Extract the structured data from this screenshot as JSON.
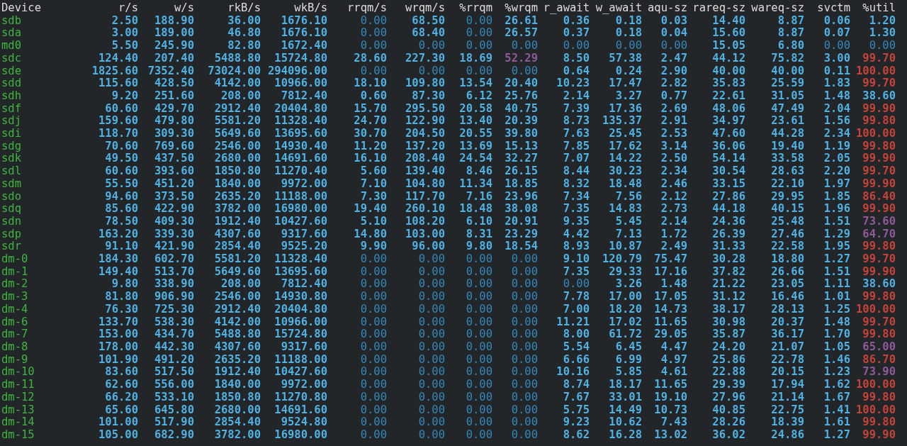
{
  "columns": [
    "Device",
    "r/s",
    "w/s",
    "rkB/s",
    "wkB/s",
    "rrqm/s",
    "wrqm/s",
    "%rrqm",
    "%wrqm",
    "r_await",
    "w_await",
    "aqu-sz",
    "rareq-sz",
    "wareq-sz",
    "svctm",
    "%util"
  ],
  "rows": [
    {
      "device": "sdb",
      "cells": [
        {
          "text": "2.50",
          "kind": "value"
        },
        {
          "text": "188.90",
          "kind": "value"
        },
        {
          "text": "36.00",
          "kind": "value"
        },
        {
          "text": "1676.10",
          "kind": "value"
        },
        {
          "text": "0.00",
          "kind": "zero"
        },
        {
          "text": "68.50",
          "kind": "value"
        },
        {
          "text": "0.00",
          "kind": "zero"
        },
        {
          "text": "26.61",
          "kind": "value"
        },
        {
          "text": "0.36",
          "kind": "value"
        },
        {
          "text": "0.18",
          "kind": "value"
        },
        {
          "text": "0.03",
          "kind": "value"
        },
        {
          "text": "14.40",
          "kind": "value"
        },
        {
          "text": "8.87",
          "kind": "value"
        },
        {
          "text": "0.06",
          "kind": "value"
        },
        {
          "text": "1.20",
          "kind": "value"
        }
      ]
    },
    {
      "device": "sda",
      "cells": [
        {
          "text": "3.00",
          "kind": "value"
        },
        {
          "text": "189.00",
          "kind": "value"
        },
        {
          "text": "46.80",
          "kind": "value"
        },
        {
          "text": "1676.10",
          "kind": "value"
        },
        {
          "text": "0.00",
          "kind": "zero"
        },
        {
          "text": "68.40",
          "kind": "value"
        },
        {
          "text": "0.00",
          "kind": "zero"
        },
        {
          "text": "26.57",
          "kind": "value"
        },
        {
          "text": "0.37",
          "kind": "value"
        },
        {
          "text": "0.18",
          "kind": "value"
        },
        {
          "text": "0.04",
          "kind": "value"
        },
        {
          "text": "15.60",
          "kind": "value"
        },
        {
          "text": "8.87",
          "kind": "value"
        },
        {
          "text": "0.07",
          "kind": "value"
        },
        {
          "text": "1.30",
          "kind": "value"
        }
      ]
    },
    {
      "device": "md0",
      "cells": [
        {
          "text": "5.50",
          "kind": "value"
        },
        {
          "text": "245.90",
          "kind": "value"
        },
        {
          "text": "82.80",
          "kind": "value"
        },
        {
          "text": "1672.40",
          "kind": "value"
        },
        {
          "text": "0.00",
          "kind": "zero"
        },
        {
          "text": "0.00",
          "kind": "zero"
        },
        {
          "text": "0.00",
          "kind": "zero"
        },
        {
          "text": "0.00",
          "kind": "zero"
        },
        {
          "text": "0.00",
          "kind": "zero"
        },
        {
          "text": "0.00",
          "kind": "zero"
        },
        {
          "text": "0.00",
          "kind": "zero"
        },
        {
          "text": "15.05",
          "kind": "value"
        },
        {
          "text": "6.80",
          "kind": "value"
        },
        {
          "text": "0.00",
          "kind": "zero"
        },
        {
          "text": "0.00",
          "kind": "zero"
        }
      ]
    },
    {
      "device": "sdc",
      "cells": [
        {
          "text": "124.40",
          "kind": "value"
        },
        {
          "text": "207.40",
          "kind": "value"
        },
        {
          "text": "5488.80",
          "kind": "value"
        },
        {
          "text": "15724.80",
          "kind": "value"
        },
        {
          "text": "28.60",
          "kind": "value"
        },
        {
          "text": "227.30",
          "kind": "value"
        },
        {
          "text": "18.69",
          "kind": "value"
        },
        {
          "text": "52.29",
          "kind": "mid"
        },
        {
          "text": "8.50",
          "kind": "value"
        },
        {
          "text": "57.38",
          "kind": "value"
        },
        {
          "text": "2.47",
          "kind": "value"
        },
        {
          "text": "44.12",
          "kind": "value"
        },
        {
          "text": "75.82",
          "kind": "value"
        },
        {
          "text": "3.00",
          "kind": "value"
        },
        {
          "text": "99.70",
          "kind": "high"
        }
      ]
    },
    {
      "device": "sde",
      "cells": [
        {
          "text": "1825.60",
          "kind": "value"
        },
        {
          "text": "7352.40",
          "kind": "value"
        },
        {
          "text": "73024.00",
          "kind": "value"
        },
        {
          "text": "294096.00",
          "kind": "value"
        },
        {
          "text": "0.00",
          "kind": "zero"
        },
        {
          "text": "0.00",
          "kind": "zero"
        },
        {
          "text": "0.00",
          "kind": "zero"
        },
        {
          "text": "0.00",
          "kind": "zero"
        },
        {
          "text": "0.64",
          "kind": "value"
        },
        {
          "text": "0.24",
          "kind": "value"
        },
        {
          "text": "2.90",
          "kind": "value"
        },
        {
          "text": "40.00",
          "kind": "value"
        },
        {
          "text": "40.00",
          "kind": "value"
        },
        {
          "text": "0.11",
          "kind": "value"
        },
        {
          "text": "100.00",
          "kind": "high"
        }
      ]
    },
    {
      "device": "sdd",
      "cells": [
        {
          "text": "115.60",
          "kind": "value"
        },
        {
          "text": "428.50",
          "kind": "value"
        },
        {
          "text": "4142.00",
          "kind": "value"
        },
        {
          "text": "10966.00",
          "kind": "value"
        },
        {
          "text": "18.10",
          "kind": "value"
        },
        {
          "text": "109.80",
          "kind": "value"
        },
        {
          "text": "13.54",
          "kind": "value"
        },
        {
          "text": "20.40",
          "kind": "value"
        },
        {
          "text": "10.23",
          "kind": "value"
        },
        {
          "text": "17.47",
          "kind": "value"
        },
        {
          "text": "2.82",
          "kind": "value"
        },
        {
          "text": "35.83",
          "kind": "value"
        },
        {
          "text": "25.59",
          "kind": "value"
        },
        {
          "text": "1.83",
          "kind": "value"
        },
        {
          "text": "99.70",
          "kind": "high"
        }
      ]
    },
    {
      "device": "sdh",
      "cells": [
        {
          "text": "9.20",
          "kind": "value"
        },
        {
          "text": "251.60",
          "kind": "value"
        },
        {
          "text": "208.00",
          "kind": "value"
        },
        {
          "text": "7812.40",
          "kind": "value"
        },
        {
          "text": "0.60",
          "kind": "value"
        },
        {
          "text": "87.30",
          "kind": "value"
        },
        {
          "text": "6.12",
          "kind": "value"
        },
        {
          "text": "25.76",
          "kind": "value"
        },
        {
          "text": "2.14",
          "kind": "value"
        },
        {
          "text": "3.27",
          "kind": "value"
        },
        {
          "text": "0.77",
          "kind": "value"
        },
        {
          "text": "22.61",
          "kind": "value"
        },
        {
          "text": "31.05",
          "kind": "value"
        },
        {
          "text": "1.48",
          "kind": "value"
        },
        {
          "text": "38.60",
          "kind": "value"
        }
      ]
    },
    {
      "device": "sdf",
      "cells": [
        {
          "text": "60.60",
          "kind": "value"
        },
        {
          "text": "429.70",
          "kind": "value"
        },
        {
          "text": "2912.40",
          "kind": "value"
        },
        {
          "text": "20404.80",
          "kind": "value"
        },
        {
          "text": "15.70",
          "kind": "value"
        },
        {
          "text": "295.50",
          "kind": "value"
        },
        {
          "text": "20.58",
          "kind": "value"
        },
        {
          "text": "40.75",
          "kind": "value"
        },
        {
          "text": "7.39",
          "kind": "value"
        },
        {
          "text": "17.36",
          "kind": "value"
        },
        {
          "text": "2.69",
          "kind": "value"
        },
        {
          "text": "48.06",
          "kind": "value"
        },
        {
          "text": "47.49",
          "kind": "value"
        },
        {
          "text": "2.04",
          "kind": "value"
        },
        {
          "text": "99.90",
          "kind": "high"
        }
      ]
    },
    {
      "device": "sdj",
      "cells": [
        {
          "text": "159.60",
          "kind": "value"
        },
        {
          "text": "479.80",
          "kind": "value"
        },
        {
          "text": "5581.20",
          "kind": "value"
        },
        {
          "text": "11328.40",
          "kind": "value"
        },
        {
          "text": "24.70",
          "kind": "value"
        },
        {
          "text": "122.90",
          "kind": "value"
        },
        {
          "text": "13.40",
          "kind": "value"
        },
        {
          "text": "20.39",
          "kind": "value"
        },
        {
          "text": "8.73",
          "kind": "value"
        },
        {
          "text": "135.37",
          "kind": "value"
        },
        {
          "text": "2.91",
          "kind": "value"
        },
        {
          "text": "34.97",
          "kind": "value"
        },
        {
          "text": "23.61",
          "kind": "value"
        },
        {
          "text": "1.56",
          "kind": "value"
        },
        {
          "text": "99.80",
          "kind": "high"
        }
      ]
    },
    {
      "device": "sdi",
      "cells": [
        {
          "text": "118.70",
          "kind": "value"
        },
        {
          "text": "309.30",
          "kind": "value"
        },
        {
          "text": "5649.60",
          "kind": "value"
        },
        {
          "text": "13695.60",
          "kind": "value"
        },
        {
          "text": "30.70",
          "kind": "value"
        },
        {
          "text": "204.50",
          "kind": "value"
        },
        {
          "text": "20.55",
          "kind": "value"
        },
        {
          "text": "39.80",
          "kind": "value"
        },
        {
          "text": "7.63",
          "kind": "value"
        },
        {
          "text": "25.45",
          "kind": "value"
        },
        {
          "text": "2.53",
          "kind": "value"
        },
        {
          "text": "47.60",
          "kind": "value"
        },
        {
          "text": "44.28",
          "kind": "value"
        },
        {
          "text": "2.34",
          "kind": "value"
        },
        {
          "text": "100.00",
          "kind": "high"
        }
      ]
    },
    {
      "device": "sdg",
      "cells": [
        {
          "text": "70.60",
          "kind": "value"
        },
        {
          "text": "769.60",
          "kind": "value"
        },
        {
          "text": "2546.00",
          "kind": "value"
        },
        {
          "text": "14930.40",
          "kind": "value"
        },
        {
          "text": "11.20",
          "kind": "value"
        },
        {
          "text": "137.20",
          "kind": "value"
        },
        {
          "text": "13.69",
          "kind": "value"
        },
        {
          "text": "15.13",
          "kind": "value"
        },
        {
          "text": "7.85",
          "kind": "value"
        },
        {
          "text": "17.62",
          "kind": "value"
        },
        {
          "text": "3.14",
          "kind": "value"
        },
        {
          "text": "36.06",
          "kind": "value"
        },
        {
          "text": "19.40",
          "kind": "value"
        },
        {
          "text": "1.19",
          "kind": "value"
        },
        {
          "text": "99.80",
          "kind": "high"
        }
      ]
    },
    {
      "device": "sdk",
      "cells": [
        {
          "text": "49.50",
          "kind": "value"
        },
        {
          "text": "437.50",
          "kind": "value"
        },
        {
          "text": "2680.00",
          "kind": "value"
        },
        {
          "text": "14691.60",
          "kind": "value"
        },
        {
          "text": "16.10",
          "kind": "value"
        },
        {
          "text": "208.40",
          "kind": "value"
        },
        {
          "text": "24.54",
          "kind": "value"
        },
        {
          "text": "32.27",
          "kind": "value"
        },
        {
          "text": "7.07",
          "kind": "value"
        },
        {
          "text": "14.22",
          "kind": "value"
        },
        {
          "text": "2.50",
          "kind": "value"
        },
        {
          "text": "54.14",
          "kind": "value"
        },
        {
          "text": "33.58",
          "kind": "value"
        },
        {
          "text": "2.05",
          "kind": "value"
        },
        {
          "text": "99.90",
          "kind": "high"
        }
      ]
    },
    {
      "device": "sdl",
      "cells": [
        {
          "text": "60.60",
          "kind": "value"
        },
        {
          "text": "393.60",
          "kind": "value"
        },
        {
          "text": "1850.80",
          "kind": "value"
        },
        {
          "text": "11270.40",
          "kind": "value"
        },
        {
          "text": "5.60",
          "kind": "value"
        },
        {
          "text": "139.40",
          "kind": "value"
        },
        {
          "text": "8.46",
          "kind": "value"
        },
        {
          "text": "26.15",
          "kind": "value"
        },
        {
          "text": "8.44",
          "kind": "value"
        },
        {
          "text": "30.23",
          "kind": "value"
        },
        {
          "text": "2.34",
          "kind": "value"
        },
        {
          "text": "30.54",
          "kind": "value"
        },
        {
          "text": "28.63",
          "kind": "value"
        },
        {
          "text": "2.20",
          "kind": "value"
        },
        {
          "text": "99.70",
          "kind": "high"
        }
      ]
    },
    {
      "device": "sdm",
      "cells": [
        {
          "text": "55.50",
          "kind": "value"
        },
        {
          "text": "451.20",
          "kind": "value"
        },
        {
          "text": "1840.00",
          "kind": "value"
        },
        {
          "text": "9972.00",
          "kind": "value"
        },
        {
          "text": "7.10",
          "kind": "value"
        },
        {
          "text": "104.80",
          "kind": "value"
        },
        {
          "text": "11.34",
          "kind": "value"
        },
        {
          "text": "18.85",
          "kind": "value"
        },
        {
          "text": "8.32",
          "kind": "value"
        },
        {
          "text": "18.48",
          "kind": "value"
        },
        {
          "text": "2.46",
          "kind": "value"
        },
        {
          "text": "33.15",
          "kind": "value"
        },
        {
          "text": "22.10",
          "kind": "value"
        },
        {
          "text": "1.97",
          "kind": "value"
        },
        {
          "text": "99.90",
          "kind": "high"
        }
      ]
    },
    {
      "device": "sdo",
      "cells": [
        {
          "text": "94.60",
          "kind": "value"
        },
        {
          "text": "373.50",
          "kind": "value"
        },
        {
          "text": "2635.20",
          "kind": "value"
        },
        {
          "text": "11188.00",
          "kind": "value"
        },
        {
          "text": "7.30",
          "kind": "value"
        },
        {
          "text": "117.70",
          "kind": "value"
        },
        {
          "text": "7.16",
          "kind": "value"
        },
        {
          "text": "23.96",
          "kind": "value"
        },
        {
          "text": "7.34",
          "kind": "value"
        },
        {
          "text": "7.56",
          "kind": "value"
        },
        {
          "text": "2.12",
          "kind": "value"
        },
        {
          "text": "27.86",
          "kind": "value"
        },
        {
          "text": "29.95",
          "kind": "value"
        },
        {
          "text": "1.85",
          "kind": "value"
        },
        {
          "text": "86.40",
          "kind": "high"
        }
      ]
    },
    {
      "device": "sdq",
      "cells": [
        {
          "text": "85.60",
          "kind": "value"
        },
        {
          "text": "422.90",
          "kind": "value"
        },
        {
          "text": "3782.00",
          "kind": "value"
        },
        {
          "text": "16980.00",
          "kind": "value"
        },
        {
          "text": "19.40",
          "kind": "value"
        },
        {
          "text": "260.10",
          "kind": "value"
        },
        {
          "text": "18.48",
          "kind": "value"
        },
        {
          "text": "38.08",
          "kind": "value"
        },
        {
          "text": "7.35",
          "kind": "value"
        },
        {
          "text": "14.83",
          "kind": "value"
        },
        {
          "text": "2.73",
          "kind": "value"
        },
        {
          "text": "44.18",
          "kind": "value"
        },
        {
          "text": "40.15",
          "kind": "value"
        },
        {
          "text": "1.96",
          "kind": "value"
        },
        {
          "text": "99.90",
          "kind": "high"
        }
      ]
    },
    {
      "device": "sdn",
      "cells": [
        {
          "text": "78.50",
          "kind": "value"
        },
        {
          "text": "409.30",
          "kind": "value"
        },
        {
          "text": "1912.40",
          "kind": "value"
        },
        {
          "text": "10427.60",
          "kind": "value"
        },
        {
          "text": "5.10",
          "kind": "value"
        },
        {
          "text": "108.20",
          "kind": "value"
        },
        {
          "text": "6.10",
          "kind": "value"
        },
        {
          "text": "20.91",
          "kind": "value"
        },
        {
          "text": "9.35",
          "kind": "value"
        },
        {
          "text": "5.45",
          "kind": "value"
        },
        {
          "text": "2.14",
          "kind": "value"
        },
        {
          "text": "24.36",
          "kind": "value"
        },
        {
          "text": "25.48",
          "kind": "value"
        },
        {
          "text": "1.51",
          "kind": "value"
        },
        {
          "text": "73.60",
          "kind": "mid"
        }
      ]
    },
    {
      "device": "sdp",
      "cells": [
        {
          "text": "163.20",
          "kind": "value"
        },
        {
          "text": "339.30",
          "kind": "value"
        },
        {
          "text": "4307.60",
          "kind": "value"
        },
        {
          "text": "9317.60",
          "kind": "value"
        },
        {
          "text": "14.80",
          "kind": "value"
        },
        {
          "text": "103.00",
          "kind": "value"
        },
        {
          "text": "8.31",
          "kind": "value"
        },
        {
          "text": "23.29",
          "kind": "value"
        },
        {
          "text": "4.42",
          "kind": "value"
        },
        {
          "text": "7.13",
          "kind": "value"
        },
        {
          "text": "1.72",
          "kind": "value"
        },
        {
          "text": "26.39",
          "kind": "value"
        },
        {
          "text": "27.46",
          "kind": "value"
        },
        {
          "text": "1.29",
          "kind": "value"
        },
        {
          "text": "64.70",
          "kind": "mid"
        }
      ]
    },
    {
      "device": "sdr",
      "cells": [
        {
          "text": "91.10",
          "kind": "value"
        },
        {
          "text": "421.90",
          "kind": "value"
        },
        {
          "text": "2854.40",
          "kind": "value"
        },
        {
          "text": "9525.20",
          "kind": "value"
        },
        {
          "text": "9.90",
          "kind": "value"
        },
        {
          "text": "96.00",
          "kind": "value"
        },
        {
          "text": "9.80",
          "kind": "value"
        },
        {
          "text": "18.54",
          "kind": "value"
        },
        {
          "text": "8.93",
          "kind": "value"
        },
        {
          "text": "10.87",
          "kind": "value"
        },
        {
          "text": "2.49",
          "kind": "value"
        },
        {
          "text": "31.33",
          "kind": "value"
        },
        {
          "text": "22.58",
          "kind": "value"
        },
        {
          "text": "1.95",
          "kind": "value"
        },
        {
          "text": "99.80",
          "kind": "high"
        }
      ]
    },
    {
      "device": "dm-0",
      "cells": [
        {
          "text": "184.30",
          "kind": "value"
        },
        {
          "text": "602.70",
          "kind": "value"
        },
        {
          "text": "5581.20",
          "kind": "value"
        },
        {
          "text": "11328.40",
          "kind": "value"
        },
        {
          "text": "0.00",
          "kind": "zero"
        },
        {
          "text": "0.00",
          "kind": "zero"
        },
        {
          "text": "0.00",
          "kind": "zero"
        },
        {
          "text": "0.00",
          "kind": "zero"
        },
        {
          "text": "9.10",
          "kind": "value"
        },
        {
          "text": "120.79",
          "kind": "value"
        },
        {
          "text": "75.47",
          "kind": "value"
        },
        {
          "text": "30.28",
          "kind": "value"
        },
        {
          "text": "18.80",
          "kind": "value"
        },
        {
          "text": "1.27",
          "kind": "value"
        },
        {
          "text": "99.70",
          "kind": "high"
        }
      ]
    },
    {
      "device": "dm-1",
      "cells": [
        {
          "text": "149.40",
          "kind": "value"
        },
        {
          "text": "513.70",
          "kind": "value"
        },
        {
          "text": "5649.60",
          "kind": "value"
        },
        {
          "text": "13695.60",
          "kind": "value"
        },
        {
          "text": "0.00",
          "kind": "zero"
        },
        {
          "text": "0.00",
          "kind": "zero"
        },
        {
          "text": "0.00",
          "kind": "zero"
        },
        {
          "text": "0.00",
          "kind": "zero"
        },
        {
          "text": "7.35",
          "kind": "value"
        },
        {
          "text": "29.33",
          "kind": "value"
        },
        {
          "text": "17.16",
          "kind": "value"
        },
        {
          "text": "37.82",
          "kind": "value"
        },
        {
          "text": "26.66",
          "kind": "value"
        },
        {
          "text": "1.51",
          "kind": "value"
        },
        {
          "text": "99.90",
          "kind": "high"
        }
      ]
    },
    {
      "device": "dm-2",
      "cells": [
        {
          "text": "9.80",
          "kind": "value"
        },
        {
          "text": "338.90",
          "kind": "value"
        },
        {
          "text": "208.00",
          "kind": "value"
        },
        {
          "text": "7812.40",
          "kind": "value"
        },
        {
          "text": "0.00",
          "kind": "zero"
        },
        {
          "text": "0.00",
          "kind": "zero"
        },
        {
          "text": "0.00",
          "kind": "zero"
        },
        {
          "text": "0.00",
          "kind": "zero"
        },
        {
          "text": "0.00",
          "kind": "zero"
        },
        {
          "text": "3.26",
          "kind": "value"
        },
        {
          "text": "1.48",
          "kind": "value"
        },
        {
          "text": "21.22",
          "kind": "value"
        },
        {
          "text": "23.05",
          "kind": "value"
        },
        {
          "text": "1.11",
          "kind": "value"
        },
        {
          "text": "38.60",
          "kind": "value"
        }
      ]
    },
    {
      "device": "dm-3",
      "cells": [
        {
          "text": "81.80",
          "kind": "value"
        },
        {
          "text": "906.90",
          "kind": "value"
        },
        {
          "text": "2546.00",
          "kind": "value"
        },
        {
          "text": "14930.80",
          "kind": "value"
        },
        {
          "text": "0.00",
          "kind": "zero"
        },
        {
          "text": "0.00",
          "kind": "zero"
        },
        {
          "text": "0.00",
          "kind": "zero"
        },
        {
          "text": "0.00",
          "kind": "zero"
        },
        {
          "text": "7.78",
          "kind": "value"
        },
        {
          "text": "17.00",
          "kind": "value"
        },
        {
          "text": "17.05",
          "kind": "value"
        },
        {
          "text": "31.12",
          "kind": "value"
        },
        {
          "text": "16.46",
          "kind": "value"
        },
        {
          "text": "1.01",
          "kind": "value"
        },
        {
          "text": "99.80",
          "kind": "high"
        }
      ]
    },
    {
      "device": "dm-4",
      "cells": [
        {
          "text": "76.30",
          "kind": "value"
        },
        {
          "text": "725.30",
          "kind": "value"
        },
        {
          "text": "2912.40",
          "kind": "value"
        },
        {
          "text": "20404.80",
          "kind": "value"
        },
        {
          "text": "0.00",
          "kind": "zero"
        },
        {
          "text": "0.00",
          "kind": "zero"
        },
        {
          "text": "0.00",
          "kind": "zero"
        },
        {
          "text": "0.00",
          "kind": "zero"
        },
        {
          "text": "7.00",
          "kind": "value"
        },
        {
          "text": "18.20",
          "kind": "value"
        },
        {
          "text": "14.73",
          "kind": "value"
        },
        {
          "text": "38.17",
          "kind": "value"
        },
        {
          "text": "28.13",
          "kind": "value"
        },
        {
          "text": "1.25",
          "kind": "value"
        },
        {
          "text": "100.00",
          "kind": "high"
        }
      ]
    },
    {
      "device": "dm-6",
      "cells": [
        {
          "text": "133.70",
          "kind": "value"
        },
        {
          "text": "538.30",
          "kind": "value"
        },
        {
          "text": "4142.00",
          "kind": "value"
        },
        {
          "text": "10966.00",
          "kind": "value"
        },
        {
          "text": "0.00",
          "kind": "zero"
        },
        {
          "text": "0.00",
          "kind": "zero"
        },
        {
          "text": "0.00",
          "kind": "zero"
        },
        {
          "text": "0.00",
          "kind": "zero"
        },
        {
          "text": "11.21",
          "kind": "value"
        },
        {
          "text": "17.02",
          "kind": "value"
        },
        {
          "text": "11.65",
          "kind": "value"
        },
        {
          "text": "30.98",
          "kind": "value"
        },
        {
          "text": "20.37",
          "kind": "value"
        },
        {
          "text": "1.48",
          "kind": "value"
        },
        {
          "text": "99.70",
          "kind": "high"
        }
      ]
    },
    {
      "device": "dm-7",
      "cells": [
        {
          "text": "153.00",
          "kind": "value"
        },
        {
          "text": "434.70",
          "kind": "value"
        },
        {
          "text": "5488.80",
          "kind": "value"
        },
        {
          "text": "15724.80",
          "kind": "value"
        },
        {
          "text": "0.00",
          "kind": "zero"
        },
        {
          "text": "0.00",
          "kind": "zero"
        },
        {
          "text": "0.00",
          "kind": "zero"
        },
        {
          "text": "0.00",
          "kind": "zero"
        },
        {
          "text": "8.00",
          "kind": "value"
        },
        {
          "text": "61.72",
          "kind": "value"
        },
        {
          "text": "29.05",
          "kind": "value"
        },
        {
          "text": "35.87",
          "kind": "value"
        },
        {
          "text": "36.17",
          "kind": "value"
        },
        {
          "text": "1.70",
          "kind": "value"
        },
        {
          "text": "99.80",
          "kind": "high"
        }
      ]
    },
    {
      "device": "dm-8",
      "cells": [
        {
          "text": "178.00",
          "kind": "value"
        },
        {
          "text": "442.30",
          "kind": "value"
        },
        {
          "text": "4307.60",
          "kind": "value"
        },
        {
          "text": "9317.60",
          "kind": "value"
        },
        {
          "text": "0.00",
          "kind": "zero"
        },
        {
          "text": "0.00",
          "kind": "zero"
        },
        {
          "text": "0.00",
          "kind": "zero"
        },
        {
          "text": "0.00",
          "kind": "zero"
        },
        {
          "text": "5.54",
          "kind": "value"
        },
        {
          "text": "6.45",
          "kind": "value"
        },
        {
          "text": "4.47",
          "kind": "value"
        },
        {
          "text": "24.20",
          "kind": "value"
        },
        {
          "text": "21.07",
          "kind": "value"
        },
        {
          "text": "1.05",
          "kind": "value"
        },
        {
          "text": "65.00",
          "kind": "mid"
        }
      ]
    },
    {
      "device": "dm-9",
      "cells": [
        {
          "text": "101.90",
          "kind": "value"
        },
        {
          "text": "491.20",
          "kind": "value"
        },
        {
          "text": "2635.20",
          "kind": "value"
        },
        {
          "text": "11188.00",
          "kind": "value"
        },
        {
          "text": "0.00",
          "kind": "zero"
        },
        {
          "text": "0.00",
          "kind": "zero"
        },
        {
          "text": "0.00",
          "kind": "zero"
        },
        {
          "text": "0.00",
          "kind": "zero"
        },
        {
          "text": "6.66",
          "kind": "value"
        },
        {
          "text": "6.99",
          "kind": "value"
        },
        {
          "text": "4.97",
          "kind": "value"
        },
        {
          "text": "25.86",
          "kind": "value"
        },
        {
          "text": "22.78",
          "kind": "value"
        },
        {
          "text": "1.46",
          "kind": "value"
        },
        {
          "text": "86.70",
          "kind": "high"
        }
      ]
    },
    {
      "device": "dm-10",
      "cells": [
        {
          "text": "83.60",
          "kind": "value"
        },
        {
          "text": "517.50",
          "kind": "value"
        },
        {
          "text": "1912.40",
          "kind": "value"
        },
        {
          "text": "10427.60",
          "kind": "value"
        },
        {
          "text": "0.00",
          "kind": "zero"
        },
        {
          "text": "0.00",
          "kind": "zero"
        },
        {
          "text": "0.00",
          "kind": "zero"
        },
        {
          "text": "0.00",
          "kind": "zero"
        },
        {
          "text": "10.16",
          "kind": "value"
        },
        {
          "text": "5.85",
          "kind": "value"
        },
        {
          "text": "4.61",
          "kind": "value"
        },
        {
          "text": "22.88",
          "kind": "value"
        },
        {
          "text": "20.15",
          "kind": "value"
        },
        {
          "text": "1.23",
          "kind": "value"
        },
        {
          "text": "73.90",
          "kind": "mid"
        }
      ]
    },
    {
      "device": "dm-11",
      "cells": [
        {
          "text": "62.60",
          "kind": "value"
        },
        {
          "text": "556.00",
          "kind": "value"
        },
        {
          "text": "1840.00",
          "kind": "value"
        },
        {
          "text": "9972.00",
          "kind": "value"
        },
        {
          "text": "0.00",
          "kind": "zero"
        },
        {
          "text": "0.00",
          "kind": "zero"
        },
        {
          "text": "0.00",
          "kind": "zero"
        },
        {
          "text": "0.00",
          "kind": "zero"
        },
        {
          "text": "8.74",
          "kind": "value"
        },
        {
          "text": "18.17",
          "kind": "value"
        },
        {
          "text": "11.65",
          "kind": "value"
        },
        {
          "text": "29.39",
          "kind": "value"
        },
        {
          "text": "17.94",
          "kind": "value"
        },
        {
          "text": "1.62",
          "kind": "value"
        },
        {
          "text": "100.00",
          "kind": "high"
        }
      ]
    },
    {
      "device": "dm-12",
      "cells": [
        {
          "text": "66.20",
          "kind": "value"
        },
        {
          "text": "533.10",
          "kind": "value"
        },
        {
          "text": "1850.80",
          "kind": "value"
        },
        {
          "text": "11270.80",
          "kind": "value"
        },
        {
          "text": "0.00",
          "kind": "zero"
        },
        {
          "text": "0.00",
          "kind": "zero"
        },
        {
          "text": "0.00",
          "kind": "zero"
        },
        {
          "text": "0.00",
          "kind": "zero"
        },
        {
          "text": "7.67",
          "kind": "value"
        },
        {
          "text": "33.01",
          "kind": "value"
        },
        {
          "text": "19.10",
          "kind": "value"
        },
        {
          "text": "27.96",
          "kind": "value"
        },
        {
          "text": "21.14",
          "kind": "value"
        },
        {
          "text": "1.67",
          "kind": "value"
        },
        {
          "text": "99.80",
          "kind": "high"
        }
      ]
    },
    {
      "device": "dm-13",
      "cells": [
        {
          "text": "65.60",
          "kind": "value"
        },
        {
          "text": "645.80",
          "kind": "value"
        },
        {
          "text": "2680.00",
          "kind": "value"
        },
        {
          "text": "14691.60",
          "kind": "value"
        },
        {
          "text": "0.00",
          "kind": "zero"
        },
        {
          "text": "0.00",
          "kind": "zero"
        },
        {
          "text": "0.00",
          "kind": "zero"
        },
        {
          "text": "0.00",
          "kind": "zero"
        },
        {
          "text": "5.75",
          "kind": "value"
        },
        {
          "text": "14.49",
          "kind": "value"
        },
        {
          "text": "10.73",
          "kind": "value"
        },
        {
          "text": "40.85",
          "kind": "value"
        },
        {
          "text": "22.75",
          "kind": "value"
        },
        {
          "text": "1.41",
          "kind": "value"
        },
        {
          "text": "100.00",
          "kind": "high"
        }
      ]
    },
    {
      "device": "dm-14",
      "cells": [
        {
          "text": "101.00",
          "kind": "value"
        },
        {
          "text": "517.90",
          "kind": "value"
        },
        {
          "text": "2854.40",
          "kind": "value"
        },
        {
          "text": "9524.80",
          "kind": "value"
        },
        {
          "text": "0.00",
          "kind": "zero"
        },
        {
          "text": "0.00",
          "kind": "zero"
        },
        {
          "text": "0.00",
          "kind": "zero"
        },
        {
          "text": "0.00",
          "kind": "zero"
        },
        {
          "text": "9.23",
          "kind": "value"
        },
        {
          "text": "10.62",
          "kind": "value"
        },
        {
          "text": "7.43",
          "kind": "value"
        },
        {
          "text": "28.26",
          "kind": "value"
        },
        {
          "text": "18.39",
          "kind": "value"
        },
        {
          "text": "1.61",
          "kind": "value"
        },
        {
          "text": "99.80",
          "kind": "high"
        }
      ]
    },
    {
      "device": "dm-15",
      "cells": [
        {
          "text": "105.00",
          "kind": "value"
        },
        {
          "text": "682.90",
          "kind": "value"
        },
        {
          "text": "3782.00",
          "kind": "value"
        },
        {
          "text": "16980.00",
          "kind": "value"
        },
        {
          "text": "0.00",
          "kind": "zero"
        },
        {
          "text": "0.00",
          "kind": "zero"
        },
        {
          "text": "0.00",
          "kind": "zero"
        },
        {
          "text": "0.00",
          "kind": "zero"
        },
        {
          "text": "8.62",
          "kind": "value"
        },
        {
          "text": "16.28",
          "kind": "value"
        },
        {
          "text": "13.02",
          "kind": "value"
        },
        {
          "text": "36.02",
          "kind": "value"
        },
        {
          "text": "24.86",
          "kind": "value"
        },
        {
          "text": "1.27",
          "kind": "value"
        },
        {
          "text": "99.90",
          "kind": "high"
        }
      ]
    }
  ]
}
